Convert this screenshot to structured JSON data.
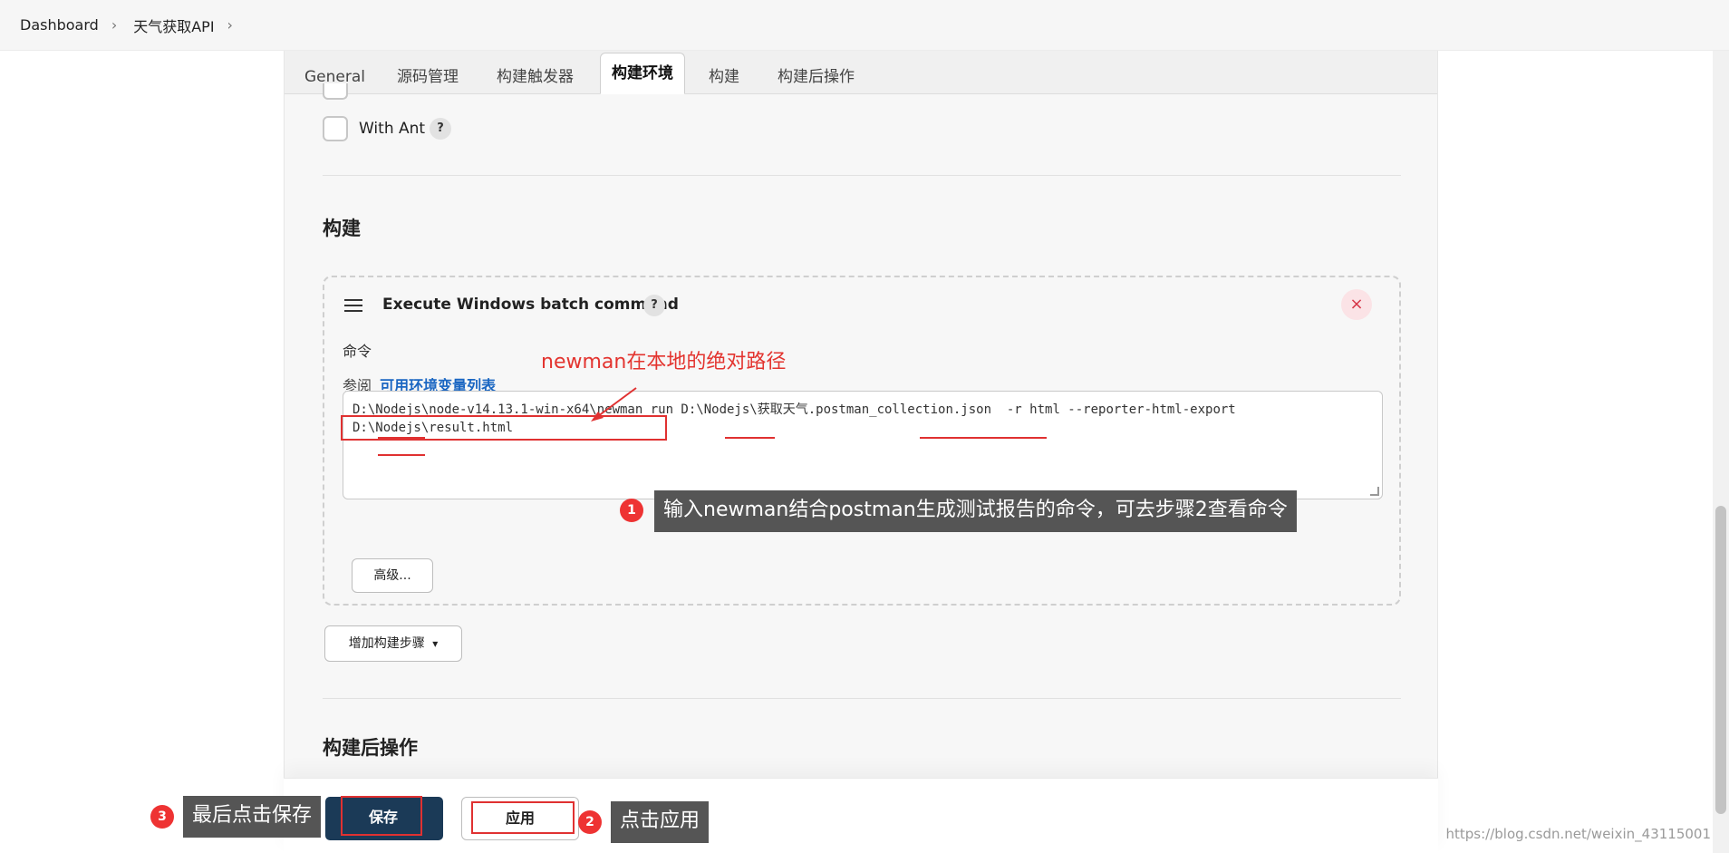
{
  "breadcrumb": {
    "items": [
      "Dashboard",
      "天气获取API"
    ],
    "separator": "›"
  },
  "tabs": [
    {
      "label": "General"
    },
    {
      "label": "源码管理"
    },
    {
      "label": "构建触发器"
    },
    {
      "label": "构建环境",
      "active": true
    },
    {
      "label": "构建"
    },
    {
      "label": "构建后操作"
    }
  ],
  "build_env": {
    "with_ant_label": "With Ant",
    "help": "?"
  },
  "build": {
    "section_title": "构建",
    "step_title": "Execute Windows batch command",
    "step_help": "?",
    "close_symbol": "×",
    "command_label": "命令",
    "see_prefix": "参阅",
    "env_link": "可用环境变量列表",
    "command": "D:\\Nodejs\\node-v14.13.1-win-x64\\newman run D:\\Nodejs\\获取天气.postman_collection.json  -r html --reporter-html-export\nD:\\Nodejs\\result.html",
    "advanced_button": "高级...",
    "add_step_button": "增加构建步骤",
    "add_step_caret": "▾"
  },
  "post_build": {
    "section_title": "构建后操作"
  },
  "footer": {
    "save_label": "保存",
    "apply_label": "应用"
  },
  "annotations": {
    "path_note": "newman在本地的绝对路径",
    "step1_text": "输入newman结合postman生成测试报告的命令，可去步骤2查看命令",
    "step1_num": "1",
    "step2_text": "点击应用",
    "step2_num": "2",
    "step3_text": "最后点击保存",
    "step3_num": "3"
  },
  "watermark": "https://blog.csdn.net/weixin_43115001",
  "colors": {
    "save_bg": "#1b3a57",
    "link": "#1a66c2",
    "annotation_red": "#e03131",
    "callout_bg": "#555555"
  }
}
